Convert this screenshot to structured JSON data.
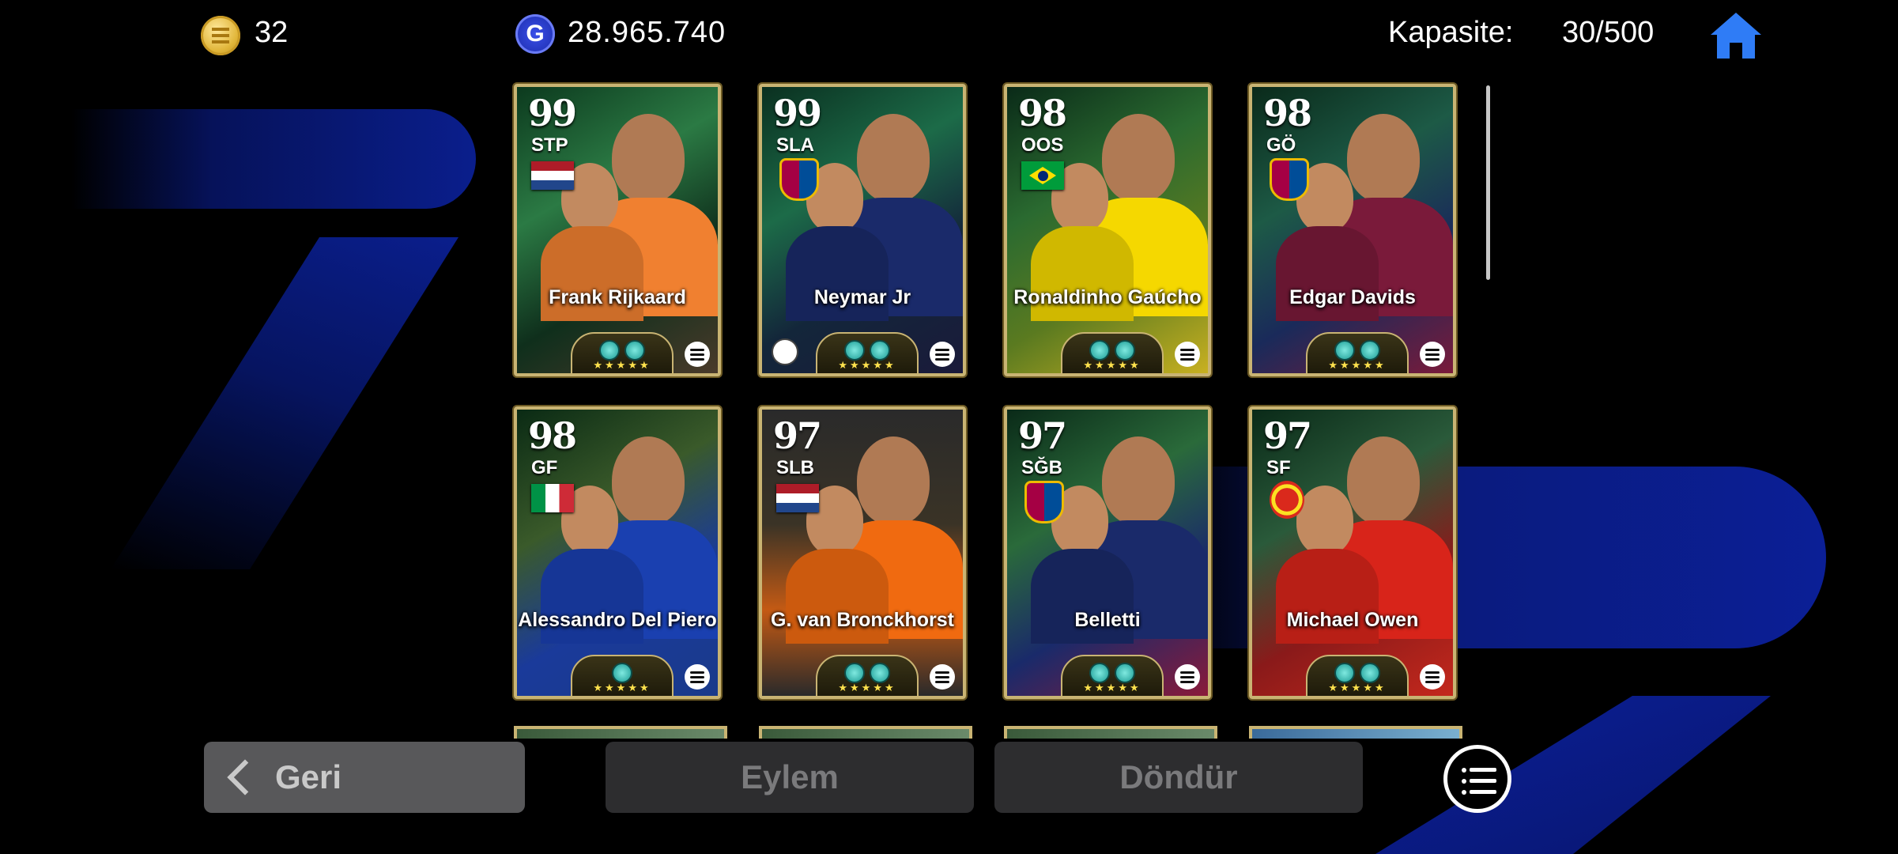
{
  "header": {
    "coins": "32",
    "gp": "28.965.740",
    "gp_icon_letter": "G",
    "capacity_label": "Kapasite:",
    "capacity_value": "30/500"
  },
  "icons": {
    "coin": "coin-icon",
    "gp": "gp-icon",
    "home": "home-icon",
    "menu": "list-menu-icon"
  },
  "cards": [
    {
      "rating": "99",
      "position": "STP",
      "name": "Frank Rijkaard",
      "badge": "flag-netherlands",
      "skills": 2,
      "stars": "★★★★★"
    },
    {
      "rating": "99",
      "position": "SLA",
      "name": "Neymar Jr",
      "badge": "club-barcelona",
      "skills": 2,
      "stars": "★★★★★"
    },
    {
      "rating": "98",
      "position": "OOS",
      "name": "Ronaldinho Gaúcho",
      "badge": "flag-brazil",
      "skills": 2,
      "stars": "★★★★★"
    },
    {
      "rating": "98",
      "position": "GÖ",
      "name": "Edgar Davids",
      "badge": "club-barcelona",
      "skills": 2,
      "stars": "★★★★★"
    },
    {
      "rating": "98",
      "position": "GF",
      "name": "Alessandro Del Piero",
      "badge": "flag-italy",
      "skills": 1,
      "stars": "★★★★★"
    },
    {
      "rating": "97",
      "position": "SLB",
      "name": "G. van Bronckhorst",
      "badge": "flag-netherlands",
      "skills": 2,
      "stars": "★★★★★"
    },
    {
      "rating": "97",
      "position": "SĞB",
      "name": "Belletti",
      "badge": "club-barcelona",
      "skills": 2,
      "stars": "★★★★★"
    },
    {
      "rating": "97",
      "position": "SF",
      "name": "Michael Owen",
      "badge": "club-manchester-united",
      "skills": 2,
      "stars": "★★★★★"
    }
  ],
  "buttons": {
    "back": "Geri",
    "action": "Eylem",
    "rotate": "Döndür"
  },
  "colors": {
    "card_border": "#c9b473",
    "accent_blue": "#0b1f96",
    "home_blue": "#2f7cf6"
  }
}
